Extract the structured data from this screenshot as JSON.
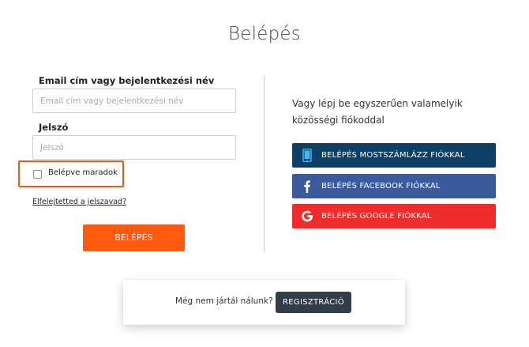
{
  "page": {
    "title": "Belépés"
  },
  "form": {
    "email": {
      "label": "Email cím vagy bejelentkezési név",
      "placeholder": "Email cím vagy bejelentkezési név",
      "value": ""
    },
    "password": {
      "label": "Jelszó",
      "placeholder": "Jelszó",
      "value": ""
    },
    "remember": {
      "label": "Belépve maradok",
      "checked": false,
      "highlight_color": "#f05a16"
    },
    "forgot_link": "Elfelejtetted a jelszavad?",
    "submit_label": "BELÉPÉS"
  },
  "social": {
    "intro": "Vagy lépj be egyszerűen valamelyik közösségi fiókoddal",
    "buttons": [
      {
        "label": "BELÉPÉS MOSTSZÁMLÁZZ FIÓKKAL",
        "icon": "phone-icon",
        "color": "#0e3f66"
      },
      {
        "label": "BELÉPÉS FACEBOOK FIÓKKAL",
        "icon": "facebook-icon",
        "color": "#3b5a9c"
      },
      {
        "label": "BELÉPÉS GOOGLE FIÓKKAL",
        "icon": "google-icon",
        "color": "#ef2c2c"
      }
    ]
  },
  "register": {
    "prompt": "Még nem jártál nálunk?",
    "button_label": "REGISZTRÁCIÓ"
  },
  "colors": {
    "primary": "#ff5a0f",
    "dark_button": "#323d4b"
  }
}
